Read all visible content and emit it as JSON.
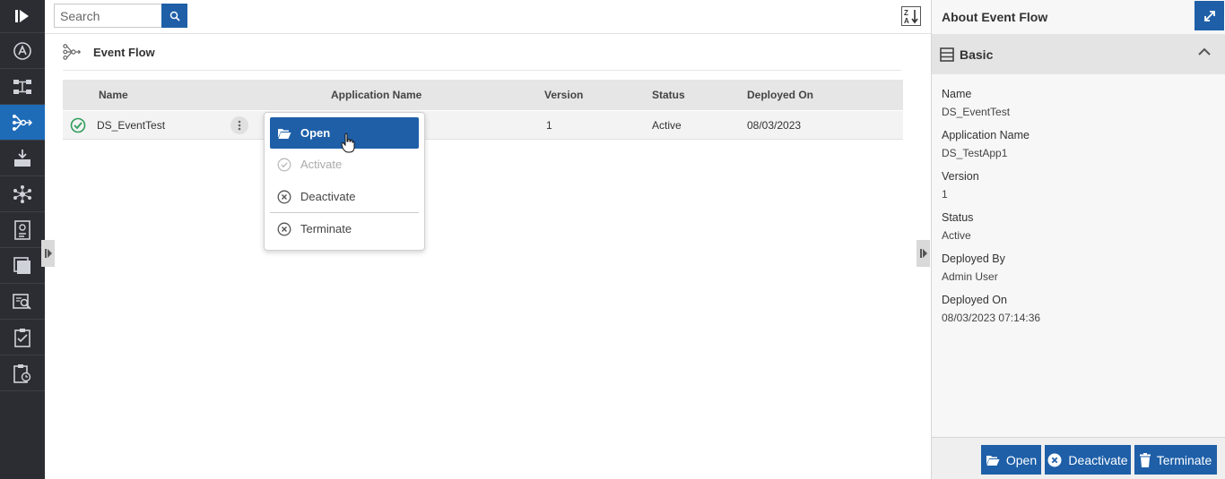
{
  "search": {
    "placeholder": "Search",
    "value": ""
  },
  "toolbar": {
    "sort_icon": "sort-z-a-icon"
  },
  "breadcrumb": {
    "label": "Event Flow"
  },
  "grid": {
    "columns": [
      "Name",
      "Application Name",
      "Version",
      "Status",
      "Deployed On"
    ],
    "rows": [
      {
        "name": "DS_EventTest",
        "application_name": "",
        "version": "1",
        "status": "Active",
        "deployed_on": "08/03/2023"
      }
    ]
  },
  "context_menu": {
    "items": [
      {
        "label": "Open",
        "icon": "folder-open-icon",
        "enabled": true,
        "highlighted": true
      },
      {
        "label": "Activate",
        "icon": "check-circle-icon",
        "enabled": false
      },
      {
        "label": "Deactivate",
        "icon": "x-circle-icon",
        "enabled": true
      },
      {
        "label": "Terminate",
        "icon": "x-circle-icon",
        "enabled": true
      }
    ]
  },
  "panel": {
    "title": "About Event Flow",
    "section_title": "Basic",
    "fields": [
      {
        "label": "Name",
        "value": "DS_EventTest"
      },
      {
        "label": "Application Name",
        "value": "DS_TestApp1"
      },
      {
        "label": "Version",
        "value": "1"
      },
      {
        "label": "Status",
        "value": "Active"
      },
      {
        "label": "Deployed By",
        "value": "Admin User"
      },
      {
        "label": "Deployed On",
        "value": "08/03/2023 07:14:36"
      }
    ],
    "buttons": {
      "open": "Open",
      "deactivate": "Deactivate",
      "terminate": "Terminate"
    }
  },
  "colors": {
    "accent": "#1e5fa8",
    "rail": "#2b2d33",
    "rail_active": "#1e6bb8",
    "success": "#2e9e5b"
  }
}
